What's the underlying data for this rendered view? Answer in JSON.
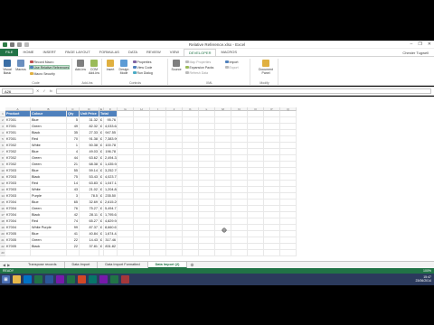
{
  "window": {
    "title": "Relative Reference.xlsx - Excel",
    "minimize": "–",
    "restore": "❐",
    "close": "✕"
  },
  "ribbon_tabs": [
    "FILE",
    "HOME",
    "INSERT",
    "PAGE LAYOUT",
    "FORMULAS",
    "DATA",
    "REVIEW",
    "VIEW",
    "DEVELOPER",
    "MACROS"
  ],
  "active_tab": "DEVELOPER",
  "user": "Chester Tugwell",
  "ribbon": {
    "code": {
      "visual_basic": "Visual Basic",
      "macros": "Macros",
      "record_macro": "Record Macro",
      "use_relative": "Use Relative References",
      "macro_security": "Macro Security",
      "label": "Code"
    },
    "addins": {
      "addins": "Add-Ins",
      "com_addins": "COM Add-Ins",
      "label": "Add-Ins"
    },
    "controls": {
      "insert": "Insert",
      "design_mode": "Design Mode",
      "properties": "Properties",
      "view_code": "View Code",
      "run_dialog": "Run Dialog",
      "label": "Controls"
    },
    "xml": {
      "source": "Source",
      "map_properties": "Map Properties",
      "expansion_packs": "Expansion Packs",
      "refresh_data": "Refresh Data",
      "import": "Import",
      "export": "Export",
      "label": "XML"
    },
    "modify": {
      "document_panel": "Document Panel",
      "label": "Modify"
    }
  },
  "formula_bar": {
    "name_box": "A26",
    "fx": "fx",
    "cancel": "✕",
    "enter": "✓",
    "value": ""
  },
  "columns": [
    "A",
    "B",
    "C",
    "D",
    "E",
    "F",
    "G",
    "H",
    "I",
    "J",
    "K",
    "L",
    "M",
    "N",
    "O",
    "P",
    "Q"
  ],
  "table": {
    "headers": [
      "Product",
      "Colour",
      "Qty",
      "Unit Price",
      "Total"
    ],
    "rows": [
      [
        "K7001",
        "Blue",
        "5",
        "31.32",
        "£",
        "95.76"
      ],
      [
        "K7001",
        "Green",
        "49",
        "82.32",
        "£",
        "4,033.68"
      ],
      [
        "K7001",
        "Black",
        "35",
        "27.33",
        "£",
        "947.55"
      ],
      [
        "K7001",
        "Red",
        "70",
        "91.38",
        "£",
        "7,383.90"
      ],
      [
        "K7002",
        "White",
        "1",
        "50.38",
        "£",
        "100.78"
      ],
      [
        "K7002",
        "Blue",
        "4",
        "49.03",
        "£",
        "196.78"
      ],
      [
        "K7002",
        "Green",
        "44",
        "63.62",
        "£",
        "2,494.32"
      ],
      [
        "K7002",
        "Green",
        "21",
        "68.38",
        "£",
        "1,435.98"
      ],
      [
        "K7003",
        "Blue",
        "55",
        "59.14",
        "£",
        "3,252.70"
      ],
      [
        "K7003",
        "Black",
        "75",
        "53.43",
        "£",
        "4,023.75"
      ],
      [
        "K7003",
        "Red",
        "14",
        "63.83",
        "£",
        "1,047.12"
      ],
      [
        "K7003",
        "White",
        "43",
        "21.02",
        "£",
        "1,204.88"
      ],
      [
        "K7003",
        "Purple",
        "3",
        "78.5",
        "£",
        "235.50"
      ],
      [
        "K7004",
        "Blue",
        "65",
        "32.69",
        "£",
        "2,615.20"
      ],
      [
        "K7004",
        "Green",
        "76",
        "75.27",
        "£",
        "5,494.71"
      ],
      [
        "K7004",
        "Black",
        "42",
        "28.11",
        "£",
        "1,795.62"
      ],
      [
        "K7004",
        "Red",
        "74",
        "65.27",
        "£",
        "4,829.98"
      ],
      [
        "K7004",
        "White Purple",
        "99",
        "87.37",
        "£",
        "8,660.67"
      ],
      [
        "K7005",
        "Blue",
        "41",
        "40.84",
        "£",
        "1,674.44"
      ],
      [
        "K7005",
        "Green",
        "22",
        "14.43",
        "£",
        "317.46"
      ],
      [
        "K7005",
        "Black",
        "22",
        "37.81",
        "£",
        "831.82"
      ]
    ]
  },
  "sheets": [
    "Transpose records",
    "Data Import",
    "Data Import Formatted",
    "Data Import (2)"
  ],
  "active_sheet": "Data Import (2)",
  "status": {
    "left": "READY",
    "right": "100%"
  },
  "taskbar": {
    "time": "15:47",
    "date": "23/06/2014"
  }
}
